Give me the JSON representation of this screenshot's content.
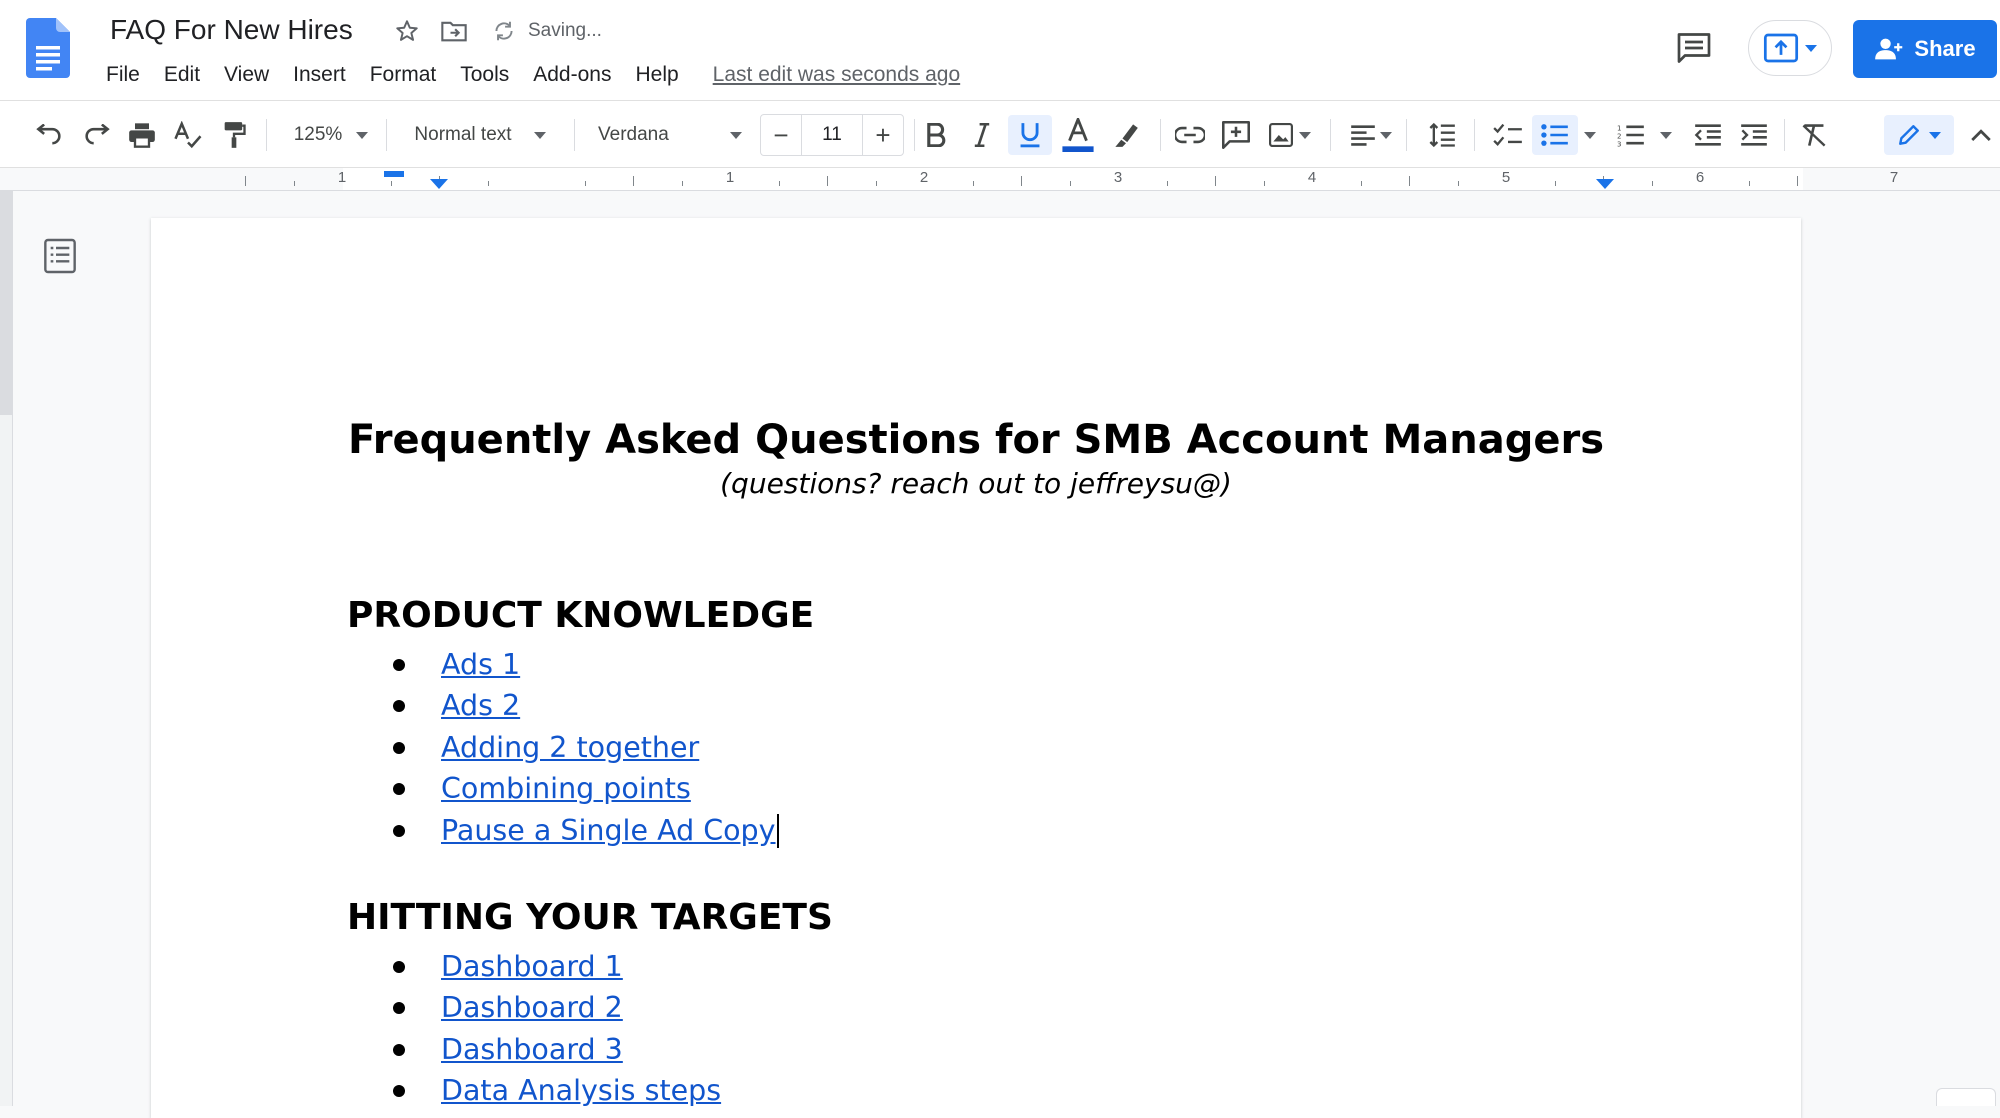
{
  "document": {
    "title": "FAQ For New Hires",
    "saving_status": "Saving...",
    "last_edit": "Last edit was seconds ago"
  },
  "menu": [
    "File",
    "Edit",
    "View",
    "Insert",
    "Format",
    "Tools",
    "Add-ons",
    "Help"
  ],
  "share_button": {
    "label": "Share"
  },
  "toolbar": {
    "zoom": "125%",
    "style": "Normal text",
    "font": "Verdana",
    "font_size": "11",
    "decrease_label": "−",
    "increase_label": "+",
    "active_formats": [
      "underline",
      "bulleted-list"
    ]
  },
  "ruler": {
    "labels": [
      "1",
      "1",
      "2",
      "3",
      "4",
      "5",
      "6",
      "7"
    ]
  },
  "content": {
    "heading": "Frequently Asked Questions for SMB Account Managers",
    "subtitle": "(questions? reach out to jeffreysu@)",
    "sections": [
      {
        "title": "PRODUCT KNOWLEDGE",
        "links": [
          "Ads 1",
          "Ads 2",
          "Adding 2 together",
          "Combining points",
          "Pause a Single Ad Copy"
        ]
      },
      {
        "title": "HITTING YOUR TARGETS",
        "links": [
          "Dashboard 1",
          "Dashboard 2",
          "Dashboard 3",
          "Data Analysis steps"
        ]
      }
    ]
  },
  "colors": {
    "accent": "#1a73e8",
    "link": "#1155cc",
    "docs_logo": "#4285f4"
  },
  "icons": {
    "logo": "google-docs-icon",
    "star": "star-icon",
    "move": "move-to-folder-icon",
    "sync": "sync-icon",
    "comments": "comments-icon",
    "present": "present-icon",
    "share": "person-add-icon"
  }
}
